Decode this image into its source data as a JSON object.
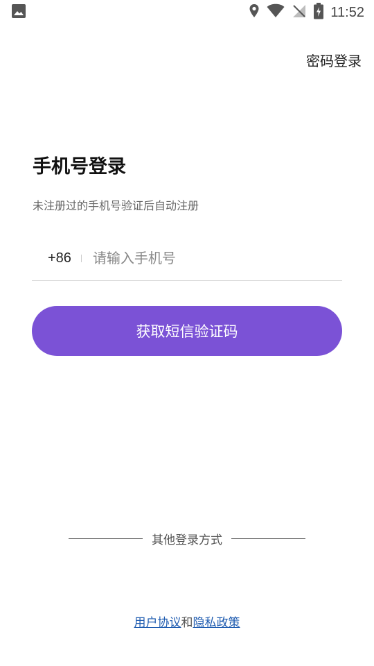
{
  "status_bar": {
    "time": "11:52",
    "icons": [
      "image-icon",
      "location-icon",
      "wifi-icon",
      "no-signal-icon",
      "battery-charging-icon"
    ]
  },
  "header": {
    "password_login": "密码登录"
  },
  "main": {
    "title": "手机号登录",
    "subtitle": "未注册过的手机号验证后自动注册",
    "country_code": "+86",
    "phone_placeholder": "请输入手机号",
    "phone_value": "",
    "sms_button": "获取短信验证码"
  },
  "other_login": {
    "label": "其他登录方式"
  },
  "agreement": {
    "user_agreement": "用户协议",
    "and": "和",
    "privacy_policy": "隐私政策"
  },
  "colors": {
    "accent": "#7b52d6",
    "link": "#1e5bb0"
  }
}
